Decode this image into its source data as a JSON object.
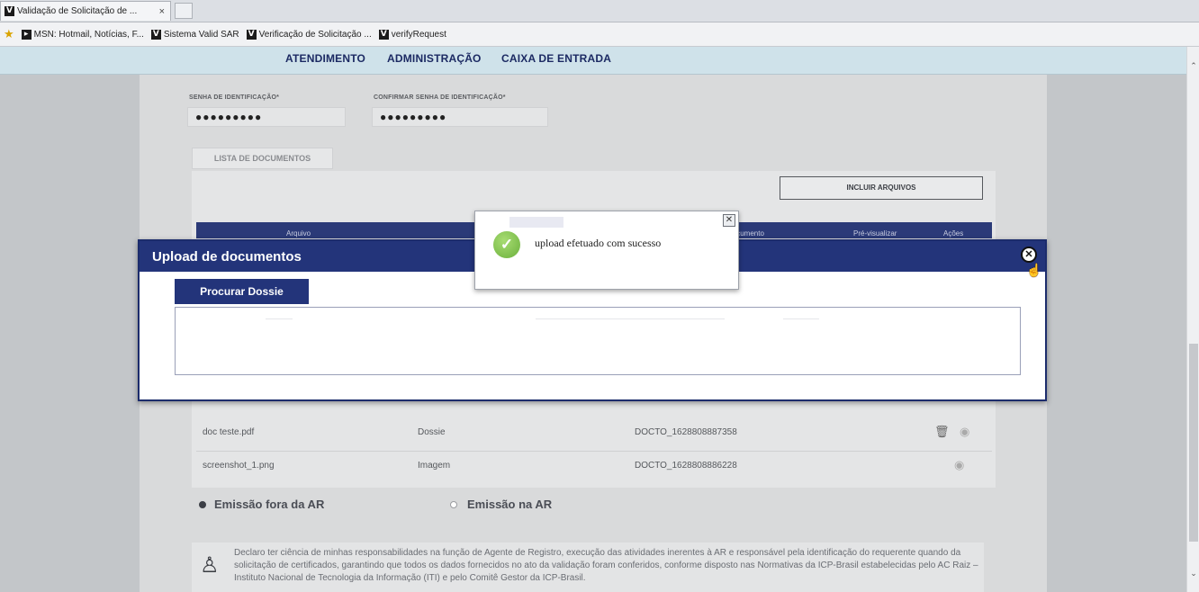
{
  "browser": {
    "tab_title": "Validação de Solicitação de ...",
    "tab_close": "×",
    "bookmarks": [
      {
        "label": "MSN: Hotmail, Notícias, F..."
      },
      {
        "label": "Sistema Valid SAR"
      },
      {
        "label": "Verificação de Solicitação ..."
      },
      {
        "label": "verifyRequest"
      }
    ]
  },
  "nav": {
    "items": [
      "ATENDIMENTO",
      "ADMINISTRAÇÃO",
      "CAIXA DE ENTRADA"
    ]
  },
  "form": {
    "senha_label": "SENHA DE IDENTIFICAÇÃO*",
    "senha_value": "●●●●●●●●●",
    "confirmar_label": "CONFIRMAR SENHA DE IDENTIFICAÇÃO*",
    "confirmar_value": "●●●●●●●●●"
  },
  "documents": {
    "tab_label": "LISTA DE DOCUMENTOS",
    "incluir_button": "INCLUIR ARQUIVOS",
    "columns": [
      "Arquivo",
      "Documento",
      "Pré-visualizar",
      "Ações"
    ],
    "rows": [
      {
        "arquivo": "doc teste.pdf",
        "tipo": "Dossie",
        "documento": "DOCTO_1628808887358"
      },
      {
        "arquivo": "screenshot_1.png",
        "tipo": "Imagem",
        "documento": "DOCTO_1628808886228"
      }
    ]
  },
  "emissao": {
    "option1": "Emissão fora da AR",
    "option2": "Emissão na AR",
    "selected": "Emissão fora da AR"
  },
  "declaration": {
    "text": "Declaro ter ciência de minhas responsabilidades na função de Agente de Registro, execução das atividades inerentes à AR e responsável pela identificação do requerente quando da solicitação de certificados, garantindo que todos os dados fornecidos no ato da validação foram conferidos, conforme disposto nas Normativas da ICP-Brasil estabelecidas pelo AC Raiz – Instituto Nacional de Tecnologia da Informação (ITI) e pelo Comitê Gestor da ICP-Brasil."
  },
  "modal": {
    "title": "Upload de documentos",
    "procurar_button": "Procurar Dossie",
    "close_glyph": "✕"
  },
  "toast": {
    "message": "upload efetuado com sucesso",
    "close_glyph": "✕"
  },
  "colors": {
    "primary": "#23347a",
    "nav_bg": "#cfe2ea",
    "success": "#6bb03c"
  }
}
